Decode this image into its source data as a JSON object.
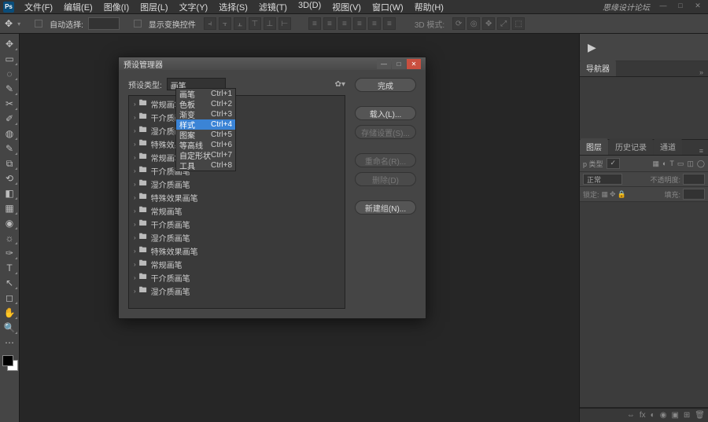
{
  "menubar": {
    "items": [
      "文件(F)",
      "编辑(E)",
      "图像(I)",
      "图层(L)",
      "文字(Y)",
      "选择(S)",
      "滤镜(T)",
      "3D(D)",
      "视图(V)",
      "窗口(W)",
      "帮助(H)"
    ],
    "brand": "思缘设计论坛"
  },
  "optionsbar": {
    "auto_select": "自动选择:",
    "layer_select": "",
    "show_transform": "显示变换控件",
    "mode_3d": "3D 模式:"
  },
  "tools": [
    {
      "icon": "✥",
      "name": "move-tool"
    },
    {
      "icon": "▭",
      "name": "marquee-tool"
    },
    {
      "icon": "◌",
      "name": "lasso-tool"
    },
    {
      "icon": "✎",
      "name": "quick-select-tool"
    },
    {
      "icon": "✂",
      "name": "crop-tool"
    },
    {
      "icon": "✐",
      "name": "eyedropper-tool"
    },
    {
      "icon": "◍",
      "name": "spot-heal-tool"
    },
    {
      "icon": "✎",
      "name": "brush-tool"
    },
    {
      "icon": "⧉",
      "name": "stamp-tool"
    },
    {
      "icon": "⟲",
      "name": "history-brush-tool"
    },
    {
      "icon": "◧",
      "name": "eraser-tool"
    },
    {
      "icon": "▦",
      "name": "gradient-tool"
    },
    {
      "icon": "◉",
      "name": "blur-tool"
    },
    {
      "icon": "☼",
      "name": "dodge-tool"
    },
    {
      "icon": "✑",
      "name": "pen-tool"
    },
    {
      "icon": "T",
      "name": "type-tool"
    },
    {
      "icon": "↖",
      "name": "path-select-tool"
    },
    {
      "icon": "◻",
      "name": "rectangle-tool"
    },
    {
      "icon": "✋",
      "name": "hand-tool"
    },
    {
      "icon": "🔍",
      "name": "zoom-tool"
    }
  ],
  "right": {
    "nav_tab": "导航器",
    "layer_tabs": [
      "图层",
      "历史记录",
      "通道"
    ],
    "kind_label": "p 类型",
    "opacity_label": "不透明度:",
    "normal": "正常",
    "lock_label": "锁定:",
    "fill_label": "填充:"
  },
  "dialog": {
    "title": "预设管理器",
    "type_label": "预设类型:",
    "type_value": "画笔",
    "buttons": {
      "done": "完成",
      "load": "载入(L)...",
      "save_set": "存储设置(S)...",
      "rename": "重命名(R)...",
      "delete": "删除(D)",
      "new_set": "新建组(N)..."
    },
    "list": [
      "常规画笔",
      "干介质画笔",
      "湿介质画笔",
      "特殊效果画笔",
      "常规画笔",
      "干介质画笔",
      "湿介质画笔",
      "特殊效果画笔",
      "常规画笔",
      "干介质画笔",
      "湿介质画笔",
      "特殊效果画笔",
      "常规画笔",
      "干介质画笔",
      "湿介质画笔"
    ]
  },
  "dropdown": {
    "items": [
      {
        "label": "画笔",
        "short": "Ctrl+1"
      },
      {
        "label": "色板",
        "short": "Ctrl+2"
      },
      {
        "label": "渐变",
        "short": "Ctrl+3"
      },
      {
        "label": "样式",
        "short": "Ctrl+4"
      },
      {
        "label": "图案",
        "short": "Ctrl+5"
      },
      {
        "label": "等高线",
        "short": "Ctrl+6"
      },
      {
        "label": "自定形状",
        "short": "Ctrl+7"
      },
      {
        "label": "工具",
        "short": "Ctrl+8"
      }
    ],
    "selected_index": 3
  }
}
